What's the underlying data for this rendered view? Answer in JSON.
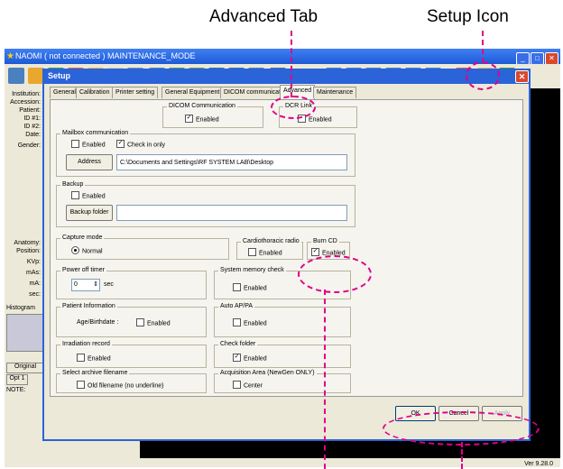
{
  "callouts": {
    "advanced_tab": "Advanced Tab",
    "setup_icon": "Setup Icon"
  },
  "colors": {
    "annotation": "#e0008a",
    "titlebar": "#2b63d8"
  },
  "app": {
    "title": "NAOMI   ( not connected )  MAINTENANCE_MODE",
    "left_labels": [
      "Institution:",
      "Accession:",
      "Patient:",
      "ID #1:",
      "ID #2:",
      "Date:",
      "Gender:",
      "Anatomy:",
      "Position:",
      "KVp:",
      "mAs:",
      "mA:",
      "sec:",
      "Histogram"
    ],
    "original_label": "Original",
    "opt_label": "Opt 1",
    "note_label": "NOTE:",
    "version": "Ver 9.28.0"
  },
  "dialog": {
    "title": "Setup",
    "tabs": [
      "General",
      "Calibration",
      "Printer setting",
      "General Equipment",
      "DICOM communication",
      "Advanced",
      "Maintenance"
    ],
    "active_tab": "Advanced",
    "dicom_comm": {
      "title": "DICOM Communication",
      "label": "Enabled",
      "checked": true
    },
    "dcr_link": {
      "title": "DCR Link",
      "label": "Enabled",
      "checked": false
    },
    "mailbox": {
      "title": "Mailbox communication",
      "enabled_label": "Enabled",
      "check_in_only_label": "Check in only",
      "address_button": "Address",
      "address_value": "C:\\Documents and Settings\\RF SYSTEM LAB\\Desktop"
    },
    "backup": {
      "title": "Backup",
      "enabled_label": "Enabled",
      "folder_button": "Backup folder",
      "folder_value": ""
    },
    "capture_mode": {
      "title": "Capture mode",
      "option": "Normal"
    },
    "cardiothoracic": {
      "title": "Cardiothoracic radio",
      "label": "Enabled"
    },
    "burn_cd": {
      "title": "Burn CD",
      "label": "Enabled",
      "checked": true
    },
    "power_off": {
      "title": "Power off timer",
      "value": "0",
      "unit": "sec"
    },
    "system_memory": {
      "title": "System memory check",
      "label": "Enabled"
    },
    "patient_info": {
      "title": "Patient Information",
      "field_label": "Age/Birthdate :",
      "label": "Enabled"
    },
    "auto_appa": {
      "title": "Auto AP/PA",
      "label": "Enabled"
    },
    "irradiation": {
      "title": "Irradiation record",
      "label": "Enabled"
    },
    "check_folder": {
      "title": "Check folder",
      "label": "Enabled",
      "checked": true
    },
    "archive": {
      "title": "Select archive filename",
      "label": "Old filename (no underline)"
    },
    "acquisition": {
      "title": "Acquisition Area (NewGen ONLY)",
      "label": "Center"
    },
    "buttons": {
      "ok": "OK",
      "cancel": "Cancel",
      "apply": "Apply"
    }
  }
}
